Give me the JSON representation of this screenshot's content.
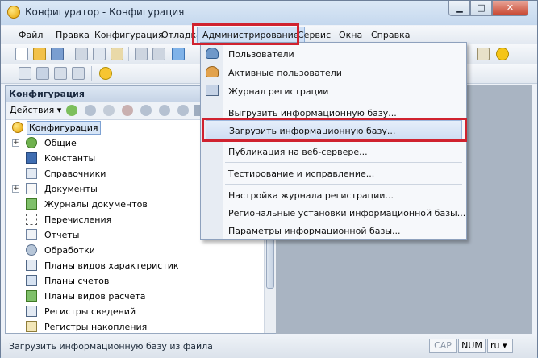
{
  "window": {
    "title": "Конфигуратор - Конфигурация"
  },
  "menu": {
    "items": [
      "Файл",
      "Правка",
      "Конфигурация",
      "Отладка",
      "Администрирование",
      "Сервис",
      "Окна",
      "Справка"
    ],
    "active_index": 4
  },
  "admin_menu": {
    "items": [
      {
        "label": "Пользователи",
        "icon": "users-icon"
      },
      {
        "label": "Активные пользователи",
        "icon": "active-users-icon"
      },
      {
        "label": "Журнал регистрации",
        "icon": "log-icon"
      },
      {
        "label": "Выгрузить информационную базу..."
      },
      {
        "label": "Загрузить информационную базу...",
        "highlighted": true
      },
      {
        "label": "Публикация на веб-сервере..."
      },
      {
        "label": "Тестирование и исправление..."
      },
      {
        "label": "Настройка журнала регистрации..."
      },
      {
        "label": "Региональные установки информационной базы..."
      },
      {
        "label": "Параметры информационной базы..."
      }
    ]
  },
  "config_panel": {
    "title": "Конфигурация",
    "actions_label": "Действия ▾",
    "tree": [
      {
        "label": "Конфигурация",
        "selected": true,
        "icon": "configuration-icon"
      },
      {
        "label": "Общие",
        "expandable": true,
        "icon": "common-icon"
      },
      {
        "label": "Константы",
        "icon": "constants-icon"
      },
      {
        "label": "Справочники",
        "icon": "catalogs-icon"
      },
      {
        "label": "Документы",
        "expandable": true,
        "icon": "documents-icon"
      },
      {
        "label": "Журналы документов",
        "icon": "document-journals-icon"
      },
      {
        "label": "Перечисления",
        "icon": "enums-icon"
      },
      {
        "label": "Отчеты",
        "icon": "reports-icon"
      },
      {
        "label": "Обработки",
        "icon": "processing-icon"
      },
      {
        "label": "Планы видов характеристик",
        "icon": "char-types-icon"
      },
      {
        "label": "Планы счетов",
        "icon": "chart-accounts-icon"
      },
      {
        "label": "Планы видов расчета",
        "icon": "calc-types-icon"
      },
      {
        "label": "Регистры сведений",
        "icon": "info-registers-icon"
      },
      {
        "label": "Регистры накопления",
        "icon": "accum-registers-icon"
      }
    ]
  },
  "status": {
    "text": "Загрузить информационную базу из файла",
    "cap": "CAP",
    "num": "NUM",
    "lang": "ru ▾"
  },
  "colors": {
    "highlight_frame": "#d0222f",
    "selection": "#d6e5f7"
  }
}
